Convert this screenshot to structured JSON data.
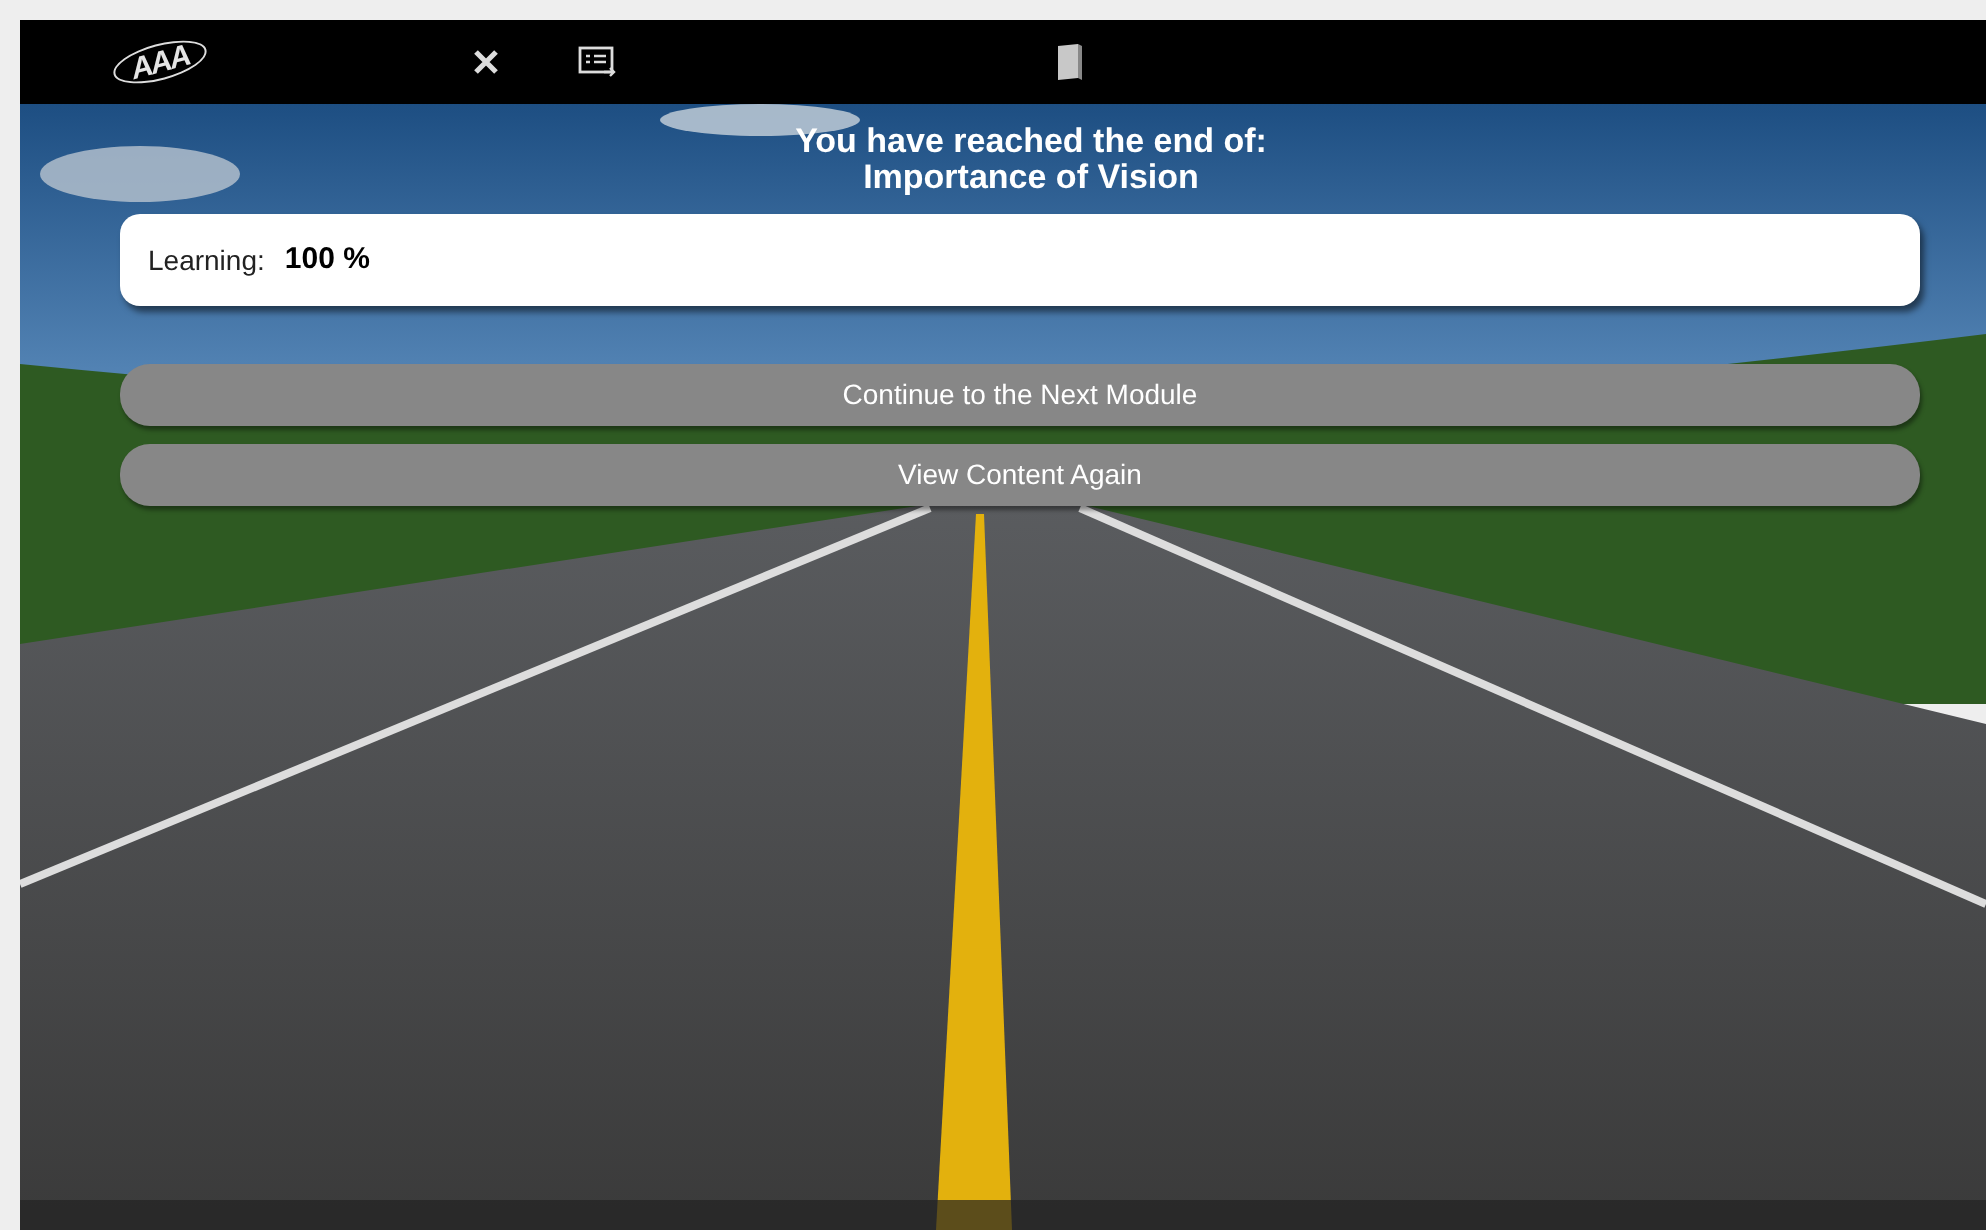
{
  "toolbar": {
    "logo_text": "AAA"
  },
  "completion": {
    "heading": "You have reached the end of:",
    "module_title": "Importance of Vision"
  },
  "progress": {
    "label": "Learning:",
    "value": "100 %"
  },
  "buttons": [
    {
      "label": "Continue to the Next Module"
    },
    {
      "label": "View Content Again"
    }
  ]
}
